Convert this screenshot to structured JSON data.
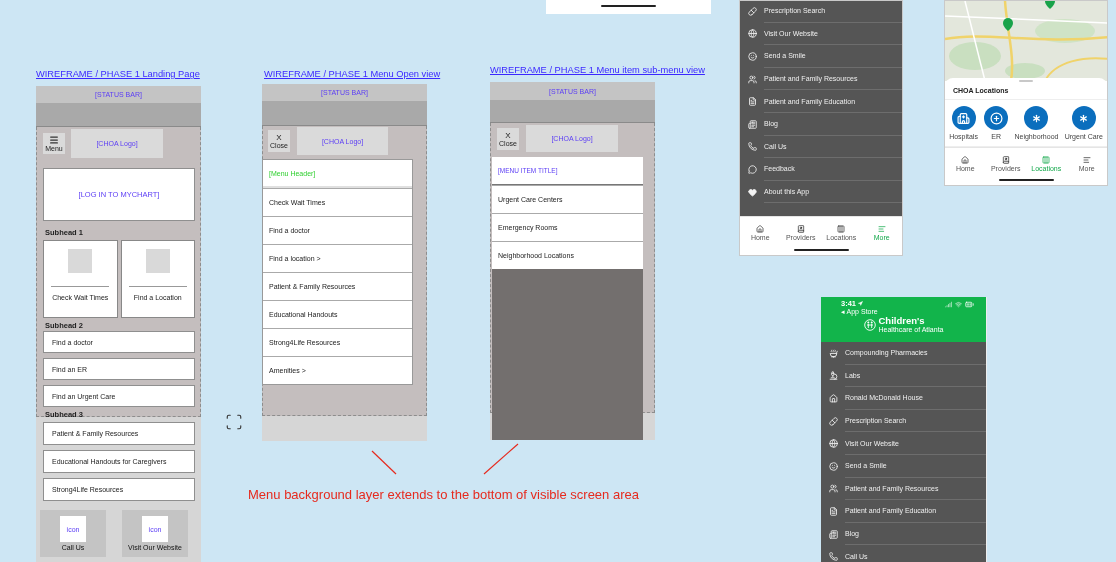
{
  "landing_wireframe": {
    "title": "WIREFRAME / PHASE 1 Landing Page",
    "status_bar": "[STATUS BAR]",
    "menu_label": "Menu",
    "logo": "[CHOA Logo]",
    "login": "[LOG IN TO MYCHART]",
    "subhead_1": "Subhead 1",
    "cards": [
      "Check Wait Times",
      "Find a Location"
    ],
    "subhead_2": "Subhead 2",
    "list_2": [
      "Find a doctor",
      "Find an ER",
      "Find an Urgent Care"
    ],
    "subhead_3": "Subhead 3",
    "list_3": [
      "Patient & Family Resources",
      "Educational Handouts for Caregivers",
      "Strong4Life Resources"
    ],
    "footer_buttons": [
      {
        "icon": "icon",
        "label": "Call Us"
      },
      {
        "icon": "icon",
        "label": "Visit Our Website"
      }
    ]
  },
  "menu_open_wireframe": {
    "title": "WIREFRAME / PHASE 1 Menu Open view",
    "status_bar": "[STATUS BAR]",
    "close_mark": "X",
    "close_label": "Close",
    "logo": "[CHOA Logo]",
    "menu_header": "[Menu Header]",
    "items": [
      "Check Wait Times",
      "Find a doctor",
      "Find a location >",
      "Patient & Family Resources",
      "Educational Handouts",
      "Strong4Life Resources",
      "Amenities >"
    ]
  },
  "submenu_wireframe": {
    "title": "WIREFRAME / PHASE 1 Menu item sub-menu view",
    "status_bar": "[STATUS BAR]",
    "close_mark": "X",
    "close_label": "Close",
    "logo": "[CHOA Logo]",
    "menu_title": "[MENU ITEM TITLE]",
    "items": [
      "Urgent Care Centers",
      "Emergency Rooms",
      "Neighborhood Locations"
    ]
  },
  "annotation": {
    "text": "Menu background layer extends to the bottom of visible screen area"
  },
  "app_menu_top": {
    "items": [
      {
        "kind": "rx",
        "label": "Prescription Search"
      },
      {
        "kind": "website",
        "label": "Visit Our Website"
      },
      {
        "kind": "smile",
        "label": "Send a Smile"
      },
      {
        "kind": "people",
        "label": "Patient and Family Resources"
      },
      {
        "kind": "education",
        "label": "Patient and Family Education"
      },
      {
        "kind": "blog",
        "label": "Blog"
      },
      {
        "kind": "phone",
        "label": "Call Us"
      },
      {
        "kind": "feedback",
        "label": "Feedback"
      },
      {
        "kind": "heart",
        "label": "About this App"
      }
    ],
    "tabs": [
      {
        "kind": "home",
        "label": "Home",
        "selected": false
      },
      {
        "kind": "providers",
        "label": "Providers",
        "selected": false
      },
      {
        "kind": "locations",
        "label": "Locations",
        "selected": false
      },
      {
        "kind": "more",
        "label": "More",
        "selected": true
      }
    ]
  },
  "app_locations": {
    "sheet_title": "CHOA Locations",
    "categories": [
      {
        "kind": "hospital",
        "label": "Hospitals"
      },
      {
        "kind": "er",
        "label": "ER"
      },
      {
        "kind": "neighborhood",
        "label": "Neighborhood"
      },
      {
        "kind": "urgent",
        "label": "Urgent Care"
      }
    ],
    "tabs": [
      {
        "kind": "home",
        "label": "Home",
        "selected": false
      },
      {
        "kind": "providers",
        "label": "Providers",
        "selected": false
      },
      {
        "kind": "locations",
        "label": "Locations",
        "selected": true
      },
      {
        "kind": "more",
        "label": "More",
        "selected": false
      }
    ]
  },
  "app_menu_bottom": {
    "status_time": "3:41",
    "back_link": "◂ App Store",
    "logo_name": "Children's",
    "logo_tagline": "Healthcare of Atlanta",
    "items": [
      {
        "kind": "pharmacy",
        "label": "Compounding Pharmacies"
      },
      {
        "kind": "labs",
        "label": "Labs"
      },
      {
        "kind": "house",
        "label": "Ronald McDonald House"
      },
      {
        "kind": "rx",
        "label": "Prescription Search"
      },
      {
        "kind": "website",
        "label": "Visit Our Website"
      },
      {
        "kind": "smile",
        "label": "Send a Smile"
      },
      {
        "kind": "people",
        "label": "Patient and Family Resources"
      },
      {
        "kind": "education",
        "label": "Patient and Family Education"
      },
      {
        "kind": "blog",
        "label": "Blog"
      },
      {
        "kind": "phone",
        "label": "Call Us"
      }
    ]
  }
}
